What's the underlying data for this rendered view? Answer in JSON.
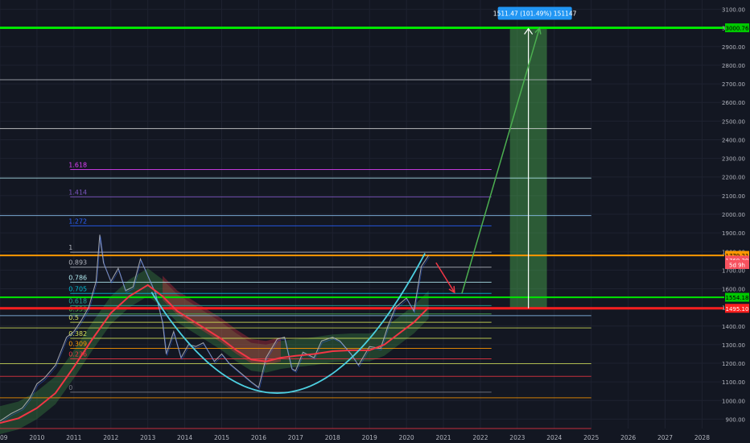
{
  "chart_data": {
    "type": "line",
    "ylim": [
      850,
      3150
    ],
    "xlim": [
      2009.0,
      2028.6
    ],
    "y_ticks": [
      900,
      1000,
      1100,
      1200,
      1300,
      1400,
      1500,
      1600,
      1700,
      1800,
      1900,
      2000,
      2100,
      2200,
      2300,
      2400,
      2500,
      2600,
      2700,
      2800,
      2900,
      3000,
      3100
    ],
    "y_tick_labels": [
      "900.00",
      "1000.00",
      "1100.00",
      "1200.00",
      "1300.00",
      "1400.00",
      "1500.00",
      "1600.00",
      "1700.00",
      "1800.00",
      "1900.00",
      "2000.00",
      "2100.00",
      "2200.00",
      "2300.00",
      "2400.00",
      "2500.00",
      "2600.00",
      "2700.00",
      "2800.00",
      "2900.00",
      "3000.00",
      "3100.00"
    ],
    "x_ticks": [
      {
        "label": "2009",
        "x": 2009.0
      },
      {
        "label": "2010",
        "x": 2010.0
      },
      {
        "label": "2011",
        "x": 2011.0
      },
      {
        "label": "2012",
        "x": 2012.0
      },
      {
        "label": "2013",
        "x": 2013.0
      },
      {
        "label": "2014",
        "x": 2014.0
      },
      {
        "label": "2015",
        "x": 2015.0
      },
      {
        "label": "2016",
        "x": 2016.0
      },
      {
        "label": "2017",
        "x": 2017.0
      },
      {
        "label": "2018",
        "x": 2018.0
      },
      {
        "label": "2019",
        "x": 2019.0
      },
      {
        "label": "2020",
        "x": 2020.0
      },
      {
        "label": "2021",
        "x": 2021.0
      },
      {
        "label": "2022",
        "x": 2022.0
      },
      {
        "label": "2023",
        "x": 2023.0
      },
      {
        "label": "2024",
        "x": 2024.0
      },
      {
        "label": "2025",
        "x": 2025.0
      },
      {
        "label": "2026",
        "x": 2026.0
      },
      {
        "label": "2027",
        "x": 2027.0
      },
      {
        "label": "2028",
        "x": 2028.0
      }
    ],
    "price": [
      [
        2009.0,
        890
      ],
      [
        2009.3,
        930
      ],
      [
        2009.6,
        960
      ],
      [
        2009.8,
        1010
      ],
      [
        2010.0,
        1090
      ],
      [
        2010.2,
        1120
      ],
      [
        2010.5,
        1190
      ],
      [
        2010.8,
        1340
      ],
      [
        2011.0,
        1370
      ],
      [
        2011.2,
        1430
      ],
      [
        2011.4,
        1500
      ],
      [
        2011.6,
        1640
      ],
      [
        2011.7,
        1890
      ],
      [
        2011.8,
        1740
      ],
      [
        2012.0,
        1640
      ],
      [
        2012.2,
        1710
      ],
      [
        2012.4,
        1590
      ],
      [
        2012.6,
        1610
      ],
      [
        2012.8,
        1760
      ],
      [
        2013.0,
        1670
      ],
      [
        2013.2,
        1580
      ],
      [
        2013.4,
        1420
      ],
      [
        2013.5,
        1250
      ],
      [
        2013.7,
        1370
      ],
      [
        2013.9,
        1230
      ],
      [
        2014.1,
        1300
      ],
      [
        2014.3,
        1290
      ],
      [
        2014.5,
        1310
      ],
      [
        2014.8,
        1210
      ],
      [
        2015.0,
        1250
      ],
      [
        2015.2,
        1200
      ],
      [
        2015.5,
        1150
      ],
      [
        2015.8,
        1100
      ],
      [
        2016.0,
        1070
      ],
      [
        2016.2,
        1230
      ],
      [
        2016.5,
        1330
      ],
      [
        2016.7,
        1340
      ],
      [
        2016.9,
        1170
      ],
      [
        2017.0,
        1160
      ],
      [
        2017.2,
        1260
      ],
      [
        2017.5,
        1230
      ],
      [
        2017.7,
        1320
      ],
      [
        2018.0,
        1340
      ],
      [
        2018.2,
        1320
      ],
      [
        2018.5,
        1250
      ],
      [
        2018.7,
        1190
      ],
      [
        2019.0,
        1290
      ],
      [
        2019.3,
        1280
      ],
      [
        2019.5,
        1400
      ],
      [
        2019.7,
        1500
      ],
      [
        2020.0,
        1550
      ],
      [
        2020.2,
        1480
      ],
      [
        2020.4,
        1720
      ],
      [
        2020.6,
        1780
      ]
    ],
    "ma_red": [
      [
        2009.0,
        880
      ],
      [
        2009.5,
        905
      ],
      [
        2010.0,
        960
      ],
      [
        2010.5,
        1040
      ],
      [
        2011.0,
        1180
      ],
      [
        2011.5,
        1330
      ],
      [
        2012.0,
        1470
      ],
      [
        2012.5,
        1560
      ],
      [
        2013.0,
        1620
      ],
      [
        2013.4,
        1560
      ],
      [
        2013.8,
        1480
      ],
      [
        2014.2,
        1430
      ],
      [
        2014.6,
        1380
      ],
      [
        2015.0,
        1330
      ],
      [
        2015.4,
        1270
      ],
      [
        2015.8,
        1220
      ],
      [
        2016.2,
        1210
      ],
      [
        2016.6,
        1230
      ],
      [
        2017.0,
        1240
      ],
      [
        2017.5,
        1250
      ],
      [
        2018.0,
        1265
      ],
      [
        2018.5,
        1270
      ],
      [
        2019.0,
        1270
      ],
      [
        2019.4,
        1300
      ],
      [
        2019.8,
        1360
      ],
      [
        2020.2,
        1420
      ],
      [
        2020.6,
        1500
      ]
    ],
    "parabola": {
      "vertex_x": 2016.5,
      "vertex_y": 1040,
      "left_x": 2013.1,
      "right_x": 2020.5,
      "top_y": 1790
    },
    "fib_levels": [
      {
        "label": "0",
        "y": 1045,
        "color": "#787b86"
      },
      {
        "label": "0.236",
        "y": 1224,
        "color": "#f23645"
      },
      {
        "label": "0.309",
        "y": 1280,
        "color": "#ff9800"
      },
      {
        "label": "0.382",
        "y": 1334,
        "color": "#d4e157"
      },
      {
        "label": "0.5",
        "y": 1420,
        "color": "#d4e157"
      },
      {
        "label": "0.559",
        "y": 1465,
        "color": "#4caf50"
      },
      {
        "label": "0.618",
        "y": 1510,
        "color": "#26a69a"
      },
      {
        "label": "0.705",
        "y": 1575,
        "color": "#00bcd4"
      },
      {
        "label": "0.786",
        "y": 1635,
        "color": "#b2ebf2"
      },
      {
        "label": "0.893",
        "y": 1716,
        "color": "#b2b5be"
      },
      {
        "label": "1",
        "y": 1796,
        "color": "#b2b5be"
      },
      {
        "label": "1.272",
        "y": 1938,
        "color": "#2962ff"
      },
      {
        "label": "1.414",
        "y": 2093,
        "color": "#7e57c2"
      },
      {
        "label": "1.618",
        "y": 2240,
        "color": "#e040fb"
      }
    ],
    "h_levels": [
      {
        "y": 850,
        "color": "#f23645"
      },
      {
        "y": 1015,
        "color": "#ff9800"
      },
      {
        "y": 1130,
        "color": "#f23645"
      },
      {
        "y": 1198,
        "color": "#d4e157"
      },
      {
        "y": 1390,
        "color": "#d4e157"
      },
      {
        "y": 1456,
        "color": "#90caf9"
      },
      {
        "y": 1555,
        "color": "#4caf50"
      },
      {
        "y": 1993,
        "color": "#90caf9"
      },
      {
        "y": 2194,
        "color": "#b2ebf2"
      },
      {
        "y": 2460,
        "color": "#e0e0e0"
      },
      {
        "y": 2722,
        "color": "#b2b5be"
      }
    ],
    "key_levels": [
      {
        "y": 3000.76,
        "color": "#00e600"
      },
      {
        "y": 1779.21,
        "color": "#ff9800"
      },
      {
        "y": 1495.1,
        "color": "#ff1f1f"
      },
      {
        "y": 1554.18,
        "color": "#00e600"
      }
    ],
    "price_tags": [
      {
        "label": "3000.76",
        "y": 3000.76,
        "bg": "#00c800",
        "fg": "#000000"
      },
      {
        "label": "1779.21",
        "y": 1779.21,
        "bg": "#ff9800",
        "fg": "#000000"
      },
      {
        "label": "1769.29",
        "y": 1754,
        "bg": "#f7525f",
        "fg": "#ffffff"
      },
      {
        "label": "5d 9h",
        "y": 1730,
        "bg": "#f7525f",
        "fg": "#ffffff"
      },
      {
        "label": "1554.18",
        "y": 1554.18,
        "bg": "#00c800",
        "fg": "#000000"
      },
      {
        "label": "1495.10",
        "y": 1495.1,
        "bg": "#ff1f1f",
        "fg": "#ffffff"
      }
    ],
    "projection": {
      "red_arrow": [
        [
          2020.8,
          1740
        ],
        [
          2021.3,
          1580
        ]
      ],
      "green_arrow": [
        [
          2021.5,
          1575
        ],
        [
          2023.6,
          3000
        ]
      ],
      "measure_x": [
        2022.8,
        2023.8
      ],
      "measure_y": [
        1495.1,
        3000.76
      ],
      "measure_label": "1511.47 (101.49%) 151147"
    }
  }
}
